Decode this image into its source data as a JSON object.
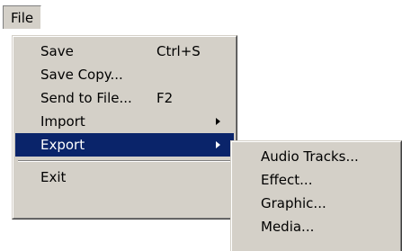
{
  "menubar": {
    "file_label": "File"
  },
  "file_menu": {
    "items": [
      {
        "label": "Save",
        "shortcut": "Ctrl+S"
      },
      {
        "label": "Save Copy..."
      },
      {
        "label": "Send to File...",
        "shortcut": "F2"
      },
      {
        "label": "Import",
        "submenu": true
      },
      {
        "label": "Export",
        "submenu": true,
        "highlighted": true
      },
      {
        "label": "Exit"
      }
    ]
  },
  "export_menu": {
    "items": [
      {
        "label": "Audio Tracks..."
      },
      {
        "label": "Effect..."
      },
      {
        "label": "Graphic..."
      },
      {
        "label": "Media..."
      }
    ]
  },
  "colors": {
    "menu_background": "#d4d0c8",
    "highlight": "#0a246a",
    "highlight_text": "#ffffff"
  }
}
